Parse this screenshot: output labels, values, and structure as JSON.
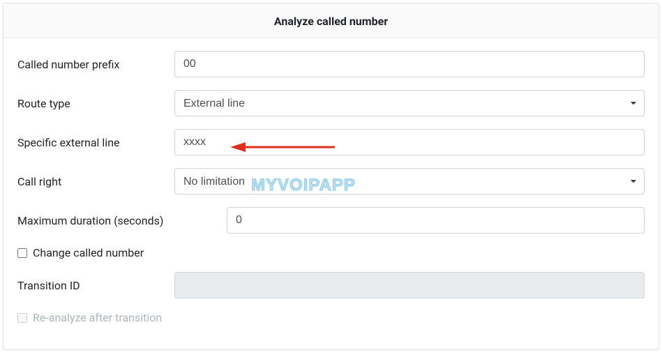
{
  "header": {
    "title": "Analyze called number"
  },
  "form": {
    "called_number_prefix": {
      "label": "Called number prefix",
      "value": "00"
    },
    "route_type": {
      "label": "Route type",
      "value": "External line"
    },
    "specific_external_line": {
      "label": "Specific external line",
      "value": "xxxx"
    },
    "call_right": {
      "label": "Call right",
      "value": "No limitation"
    },
    "maximum_duration": {
      "label": "Maximum duration (seconds)",
      "value": "0"
    },
    "change_called_number": {
      "label": "Change called number"
    },
    "transition_id": {
      "label": "Transition ID",
      "value": ""
    },
    "reanalyze_after_transition": {
      "label": "Re-analyze after transition"
    }
  },
  "watermark": "MYVOIPAPP"
}
